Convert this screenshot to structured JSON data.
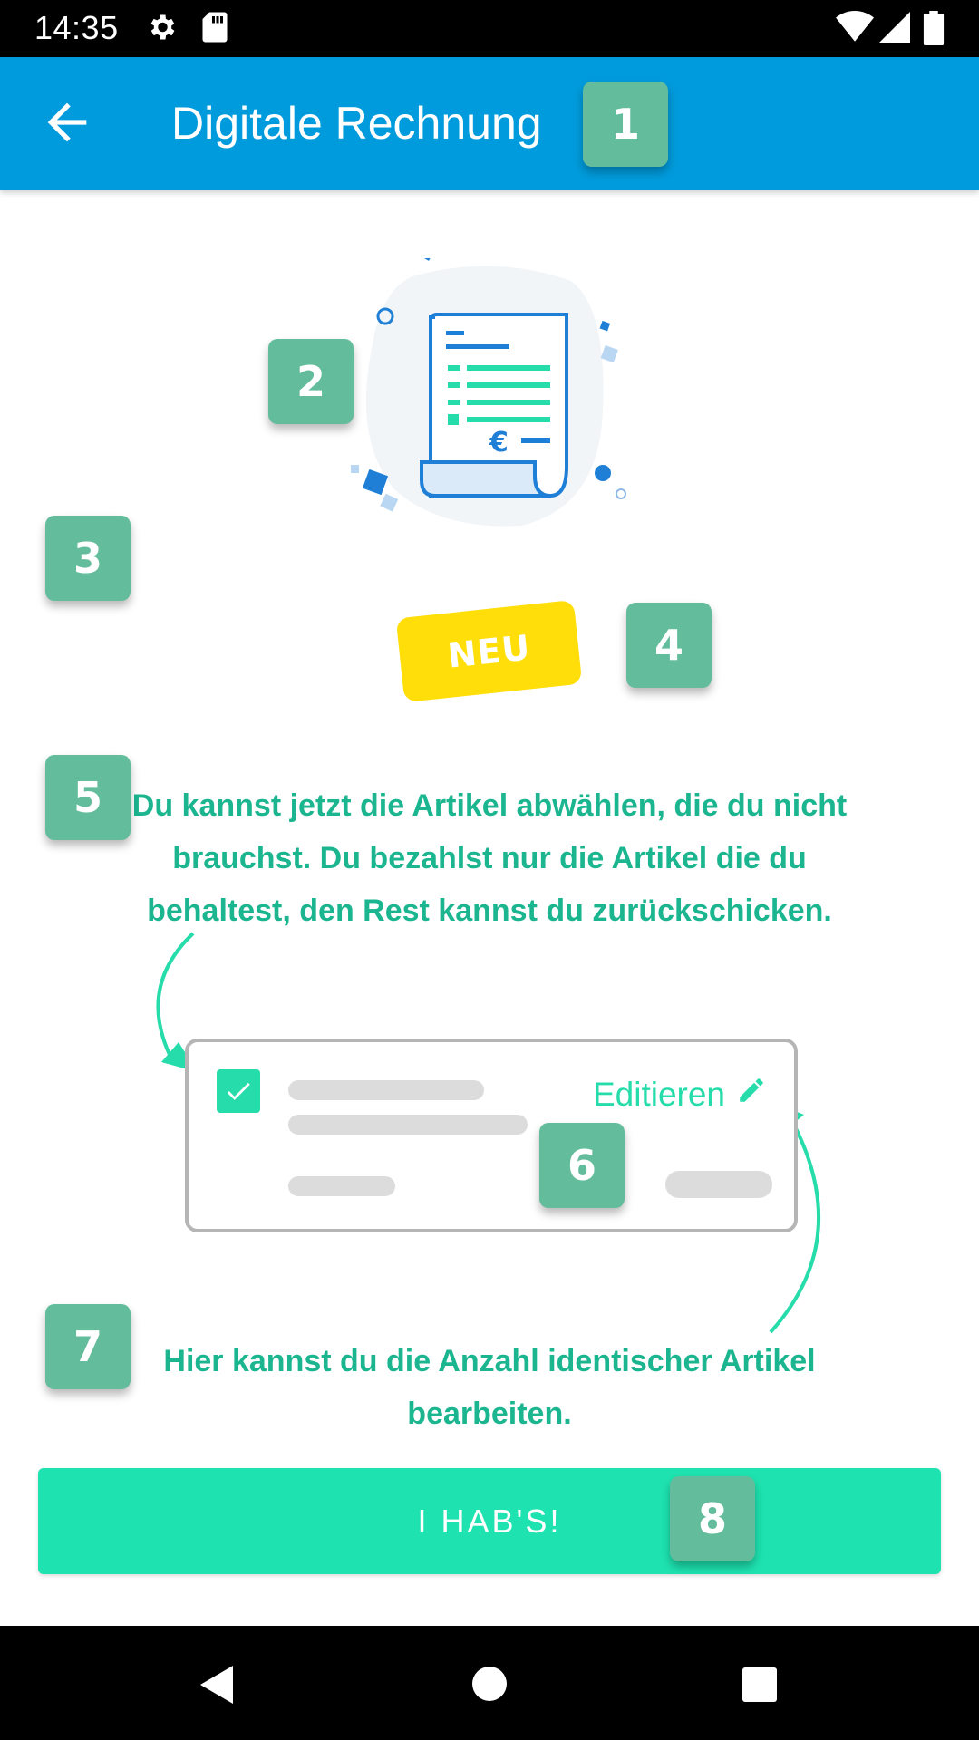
{
  "status_bar": {
    "time": "14:35",
    "icons": [
      "gear-icon",
      "sd-card-icon",
      "wifi-icon",
      "signal-icon",
      "battery-icon"
    ]
  },
  "app_bar": {
    "title": "Digitale Rechnung",
    "back_icon": "arrow-back-icon",
    "color": "#009bdc"
  },
  "badges": [
    "1",
    "2",
    "3",
    "4",
    "5",
    "6",
    "7",
    "8"
  ],
  "new_tag": {
    "label": "NEU",
    "color": "#ffde0a"
  },
  "hint_top": "Du kannst jetzt die Artikel abwählen, die du nicht brauchst. Du bezahlst nur die Artikel die du behaltest, den Rest kannst du zurückschicken.",
  "card": {
    "edit_label": "Editieren",
    "check_icon": "checkbox-checked-icon",
    "edit_icon": "pencil-icon"
  },
  "hint_bottom": "Hier kannst du die Anzahl identischer Artikel bearbeiten.",
  "cta": {
    "label": "I HAB'S!",
    "color": "#1ee3b0"
  },
  "nav_bar": {
    "icons": [
      "back-triangle-icon",
      "home-circle-icon",
      "recents-square-icon"
    ]
  },
  "colors": {
    "accent": "#1bb58f",
    "badge": "#63bd9c"
  }
}
